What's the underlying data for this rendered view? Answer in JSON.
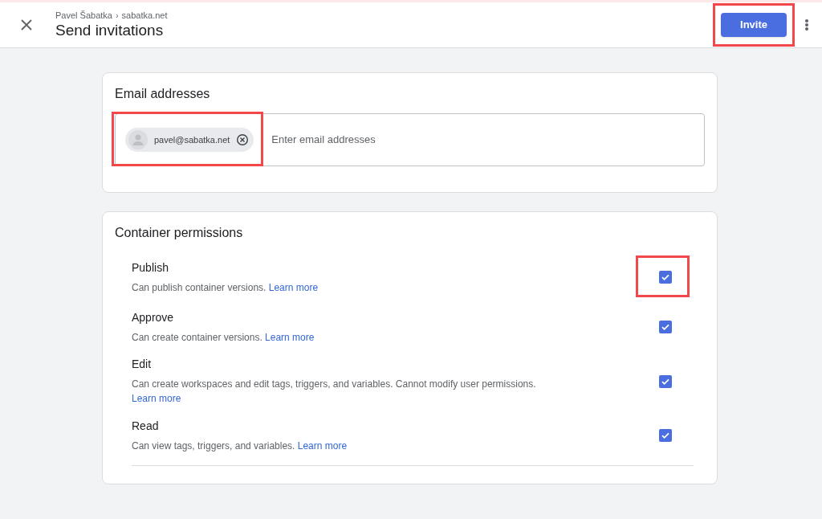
{
  "header": {
    "breadcrumb": [
      {
        "label": "Pavel Šabatka"
      },
      {
        "label": "sabatka.net"
      }
    ],
    "breadcrumb_separator": "›",
    "title": "Send invitations",
    "invite_button": {
      "label": "Invite",
      "highlighted": true
    }
  },
  "email_card": {
    "title": "Email addresses",
    "chips": [
      {
        "label": "pavel@sabatka.net",
        "highlighted": true
      }
    ],
    "placeholder": "Enter email addresses"
  },
  "permissions_card": {
    "title": "Container permissions",
    "permissions": [
      {
        "name": "Publish",
        "description": "Can publish container versions.",
        "link": "Learn more",
        "checked": true,
        "highlighted": true
      },
      {
        "name": "Approve",
        "description": "Can create container versions.",
        "link": "Learn more",
        "checked": true,
        "highlighted": false
      },
      {
        "name": "Edit",
        "description": "Can create workspaces and edit tags, triggers, and variables. Cannot modify user permissions.",
        "link": "Learn more",
        "checked": true,
        "highlighted": false
      },
      {
        "name": "Read",
        "description": "Can view tags, triggers, and variables.",
        "link": "Learn more",
        "checked": true,
        "highlighted": false
      }
    ]
  }
}
